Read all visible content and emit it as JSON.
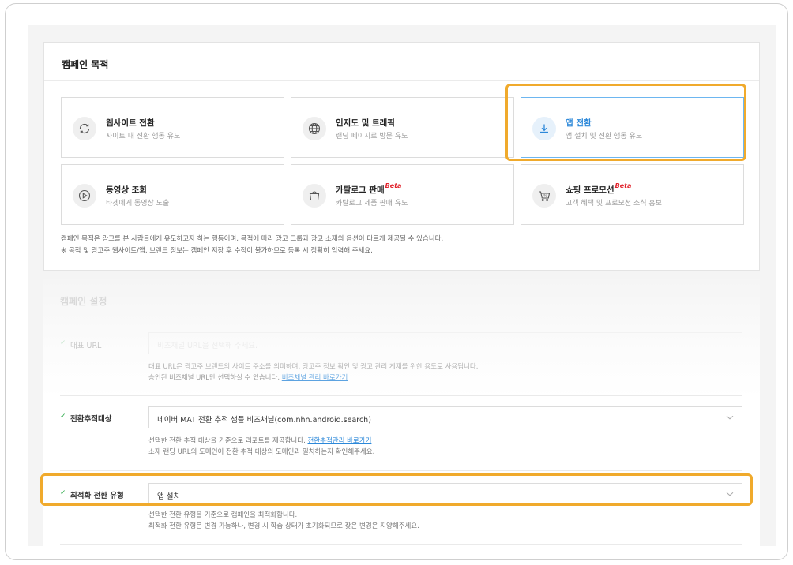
{
  "campaign_purpose": {
    "title": "캠페인 목적",
    "objectives": [
      {
        "label": "웹사이트 전환",
        "desc": "사이트 내 전환 행동 유도",
        "icon": "refresh-cycle-icon",
        "selected": false,
        "beta": ""
      },
      {
        "label": "인지도 및 트래픽",
        "desc": "랜딩 페이지로 방문 유도",
        "icon": "globe-icon",
        "selected": false,
        "beta": ""
      },
      {
        "label": "앱 전환",
        "desc": "앱 설치 및 전환 행동 유도",
        "icon": "download-icon",
        "selected": true,
        "beta": ""
      },
      {
        "label": "동영상 조회",
        "desc": "타겟에게 동영상 노출",
        "icon": "play-circle-icon",
        "selected": false,
        "beta": ""
      },
      {
        "label": "카탈로그 판매",
        "desc": "카탈로그 제품 판매 유도",
        "icon": "shopping-bag-icon",
        "selected": false,
        "beta": "Beta"
      },
      {
        "label": "쇼핑 프로모션",
        "desc": "고객 혜택 및 프로모션 소식 홍보",
        "icon": "shopping-cart-icon",
        "selected": false,
        "beta": "Beta"
      }
    ],
    "notes": [
      "캠페인 목적은 광고를 본 사람들에게 유도하고자 하는 행동이며, 목적에 따라 광고 그룹과 광고 소재의 옵션이 다르게 제공될 수 있습니다.",
      "※ 목적 및 광고주 웹사이트/앱, 브랜드 정보는 캠페인 저장 후 수정이 불가하므로 등록 시 정확히 입력해 주세요."
    ]
  },
  "campaign_settings": {
    "title": "캠페인 설정",
    "rep_url": {
      "label": "대표 URL",
      "placeholder": "비즈채널 URL을 선택해 주세요.",
      "help1": "대표 URL은 광고주 브랜드의 사이트 주소를 의미하며, 광고주 정보 확인 및 광고 관리 게재를 위한 용도로 사용됩니다.",
      "help2": "승인된 비즈채널 URL만 선택하실 수 있습니다.",
      "link": "비즈채널 관리 바로가기"
    },
    "conversion_target": {
      "label": "전환추적대상",
      "value": "네이버 MAT 전환 추적 샘플 비즈채널(com.nhn.android.search)",
      "help1": "선택한 전환 추적 대상을 기준으로 리포트를 제공합니다.",
      "link": "전환추적관리 바로가기",
      "help2": "소재 랜딩 URL의 도메인이 전환 추적 대상의 도메인과 일치하는지 확인해주세요."
    },
    "optimization_type": {
      "label": "최적화 전환 유형",
      "value": "앱 설치",
      "help1": "선택한 전환 유형을 기준으로 캠페인을 최적화합니다.",
      "help2": "최적화 전환 유형은 변경 가능하나, 변경 시 학습 상태가 초기화되므로 잦은 변경은 지양해주세요."
    }
  },
  "colors": {
    "highlight": "#f0aa2c",
    "selected_blue": "#2c88d9",
    "check_green": "#27a845",
    "beta_red": "#e0222b"
  }
}
